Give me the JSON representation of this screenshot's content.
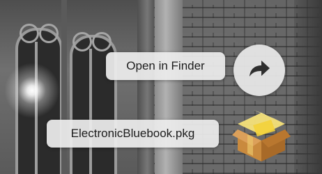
{
  "overlay": {
    "open_in_finder_label": "Open in Finder",
    "file_name": "ElectronicBluebook.pkg",
    "share_button_icon": "curved-arrow-right-icon",
    "package_icon": "package-box-icon"
  },
  "colors": {
    "pill_background": "#ececec",
    "text": "#1d1d1d",
    "box_brown": "#c98a3e",
    "box_tape_yellow": "#f3d23a"
  }
}
